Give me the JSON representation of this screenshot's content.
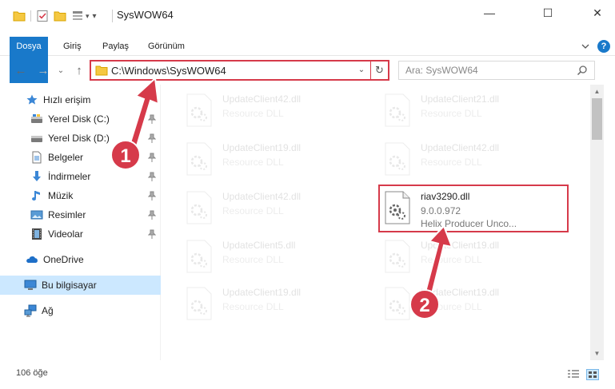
{
  "window": {
    "title": "SysWOW64",
    "minimize_glyph": "—",
    "maximize_glyph": "☐",
    "close_glyph": "✕"
  },
  "ribbon": {
    "tabs": [
      "Dosya",
      "Giriş",
      "Paylaş",
      "Görünüm"
    ],
    "help_glyph": "?"
  },
  "nav": {
    "back_glyph": "←",
    "forward_glyph": "→",
    "up_glyph": "↑",
    "recent_glyph": "⌄",
    "address": "C:\\Windows\\SysWOW64",
    "dropdown_glyph": "⌄",
    "refresh_glyph": "↻",
    "search_placeholder": "Ara: SysWOW64"
  },
  "sidebar": {
    "items": [
      {
        "label": "Hızlı erişim",
        "icon": "star-icon",
        "pinned": false
      },
      {
        "label": "Yerel Disk (C:)",
        "icon": "drive-icon",
        "pinned": true
      },
      {
        "label": "Yerel Disk (D:)",
        "icon": "drive-icon",
        "pinned": true
      },
      {
        "label": "Belgeler",
        "icon": "documents-icon",
        "pinned": true
      },
      {
        "label": "İndirmeler",
        "icon": "downloads-icon",
        "pinned": true
      },
      {
        "label": "Müzik",
        "icon": "music-icon",
        "pinned": true
      },
      {
        "label": "Resimler",
        "icon": "pictures-icon",
        "pinned": true
      },
      {
        "label": "Videolar",
        "icon": "videos-icon",
        "pinned": true
      },
      {
        "label": "OneDrive",
        "icon": "onedrive-icon",
        "pinned": false
      },
      {
        "label": "Bu bilgisayar",
        "icon": "computer-icon",
        "pinned": false
      },
      {
        "label": "Ağ",
        "icon": "network-icon",
        "pinned": false
      }
    ],
    "pin_glyph": "📌"
  },
  "files": [
    {
      "name": "UpdateClient42.dll",
      "line2": "Resource DLL",
      "line3": "",
      "faded": true
    },
    {
      "name": "UpdateClient21.dll",
      "line2": "Resource DLL",
      "line3": "",
      "faded": true
    },
    {
      "name": "UpdateClient19.dll",
      "line2": "Resource DLL",
      "line3": "",
      "faded": true
    },
    {
      "name": "UpdateClient42.dll",
      "line2": "Resource DLL",
      "line3": "",
      "faded": true
    },
    {
      "name": "UpdateClient42.dll",
      "line2": "Resource DLL",
      "line3": "",
      "faded": true
    },
    {
      "name": "riav3290.dll",
      "line2": "9.0.0.972",
      "line3": "Helix Producer Unco...",
      "faded": false
    },
    {
      "name": "UpdateClient5.dll",
      "line2": "Resource DLL",
      "line3": "",
      "faded": true
    },
    {
      "name": "UpdateClient19.dll",
      "line2": "Resource DLL",
      "line3": "",
      "faded": true
    },
    {
      "name": "UpdateClient19.dll",
      "line2": "Resource DLL",
      "line3": "",
      "faded": true
    },
    {
      "name": "UpdateClient19.dll",
      "line2": "Resource DLL",
      "line3": "",
      "faded": true
    }
  ],
  "status": {
    "count": "106 öğe"
  },
  "annotations": {
    "badge1": "1",
    "badge2": "2",
    "accent": "#d63a4a"
  },
  "colors": {
    "ribbon_file_tab": "#1979ca",
    "selection": "#cce8ff"
  }
}
